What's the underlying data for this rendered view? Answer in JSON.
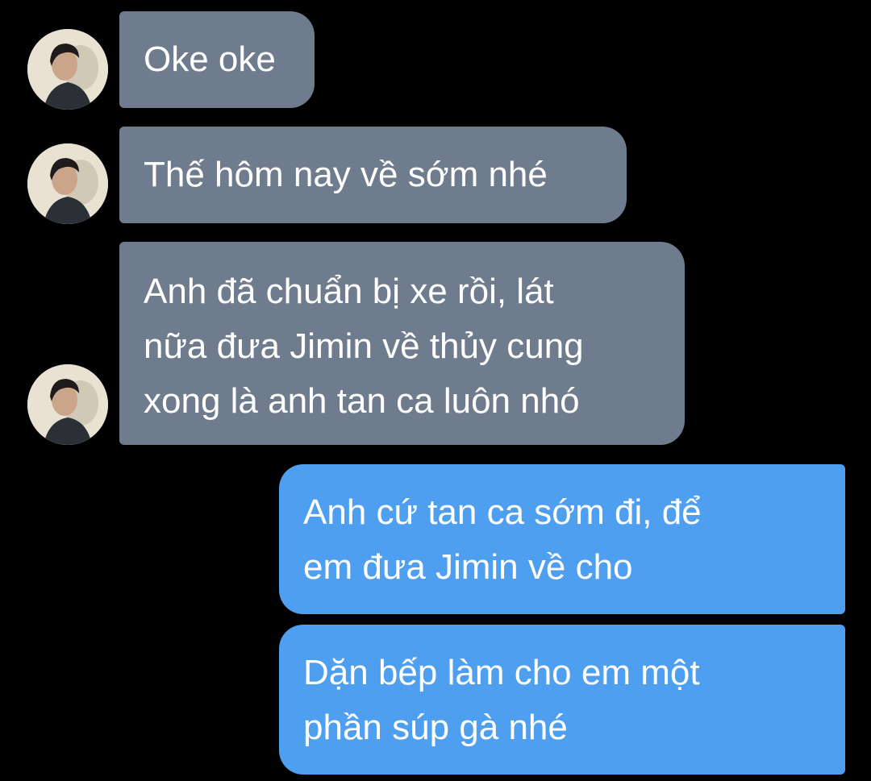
{
  "conversation": {
    "messages": [
      {
        "sender": "contact",
        "text": "Oke oke"
      },
      {
        "sender": "contact",
        "text": "Thế hôm nay về sớm nhé"
      },
      {
        "sender": "contact",
        "text": "Anh đã chuẩn bị xe rồi, lát\nnữa đưa Jimin về thủy cung\nxong là anh tan ca luôn nhó"
      },
      {
        "sender": "self",
        "text": "Anh cứ tan ca sớm đi, để\nem đưa Jimin về cho"
      },
      {
        "sender": "self",
        "text": "Dặn bếp làm cho em một\nphần súp gà nhé"
      }
    ]
  },
  "colors": {
    "background": "#000000",
    "incoming_bubble": "#6f7c8d",
    "outgoing_bubble": "#4f9ff0",
    "text": "#ffffff"
  },
  "icons": {
    "avatar": "contact-avatar-photo"
  }
}
